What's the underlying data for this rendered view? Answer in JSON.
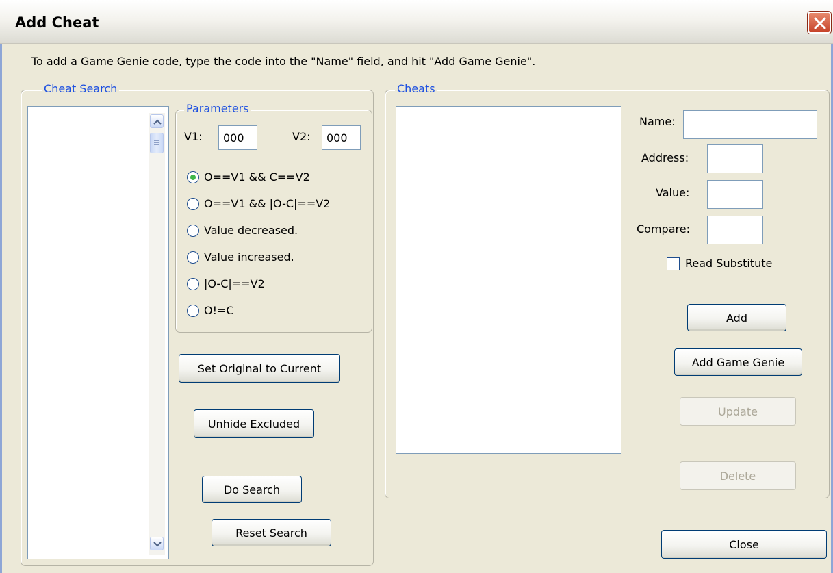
{
  "window": {
    "title": "Add Cheat"
  },
  "instructions": "To add a Game Genie code, type the code into the \"Name\" field, and hit \"Add Game Genie\".",
  "cheat_search": {
    "legend": "Cheat Search",
    "parameters": {
      "legend": "Parameters",
      "v1_label": "V1:",
      "v1_value": "000",
      "v2_label": "V2:",
      "v2_value": "000",
      "options": [
        {
          "label": "O==V1 && C==V2",
          "selected": true
        },
        {
          "label": "O==V1 && |O-C|==V2",
          "selected": false
        },
        {
          "label": "Value decreased.",
          "selected": false
        },
        {
          "label": "Value increased.",
          "selected": false
        },
        {
          "label": "|O-C|==V2",
          "selected": false
        },
        {
          "label": "O!=C",
          "selected": false
        }
      ]
    },
    "buttons": {
      "set_original": "Set Original to Current",
      "unhide_excluded": "Unhide Excluded",
      "do_search": "Do Search",
      "reset_search": "Reset Search"
    }
  },
  "cheats": {
    "legend": "Cheats",
    "name_label": "Name:",
    "name_value": "",
    "address_label": "Address:",
    "address_value": "",
    "value_label": "Value:",
    "value_value": "",
    "compare_label": "Compare:",
    "compare_value": "",
    "read_substitute_label": "Read Substitute",
    "read_substitute_checked": false,
    "buttons": {
      "add": "Add",
      "add_game_genie": "Add Game Genie",
      "update": "Update",
      "delete": "Delete"
    }
  },
  "close_button": "Close",
  "colors": {
    "legend_text": "#1c4fe0",
    "radio_selected": "#3fb64a",
    "close_x": "#c6432a"
  }
}
